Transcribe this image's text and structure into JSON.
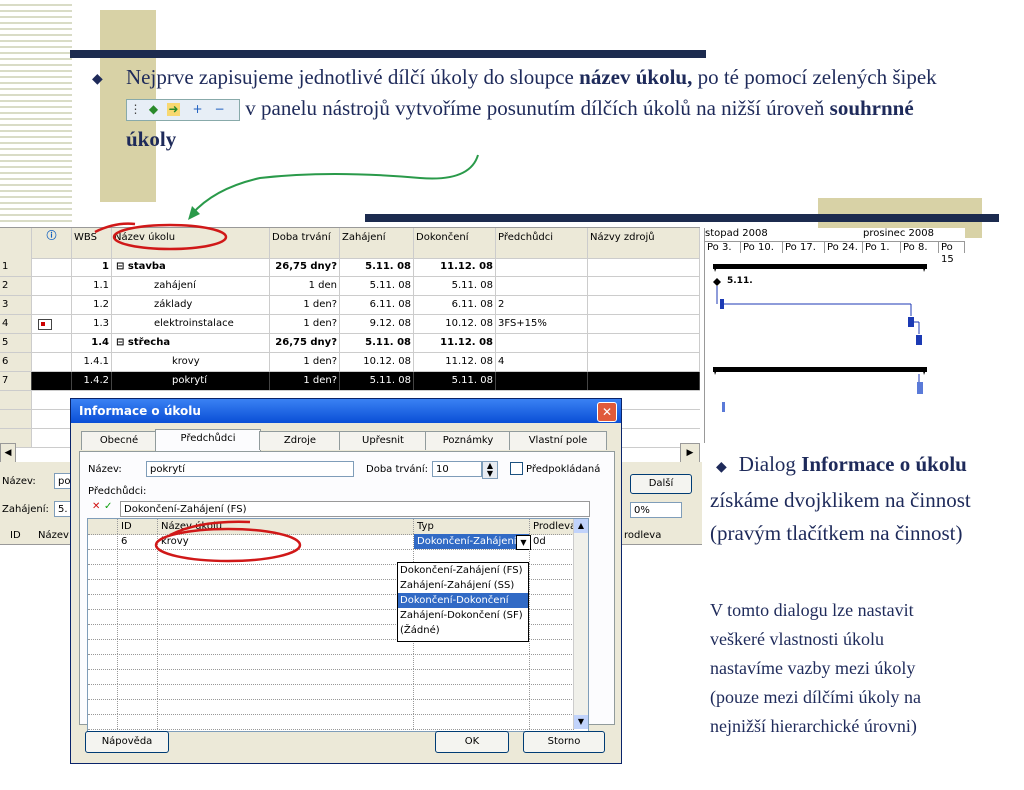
{
  "slide": {
    "bullet1": {
      "t1": "Nejprve zapisujeme jednotlivé dílčí úkoly do sloupce ",
      "b1": "název úkolu,",
      "t2": " po té pomocí zelených šipek ",
      "t3": " v panelu nástrojů vytvoříme posunutím dílčích úkolů na nižší úroveň ",
      "b2": "souhrnné úkoly"
    },
    "bullet2": {
      "t1": "Dialog ",
      "b1": "Informace o úkolu",
      "t2": " získáme dvojklikem na činnost (pravým tlačítkem na činnost)"
    },
    "notes": [
      "V tomto dialogu lze nastavit",
      "veškeré vlastnosti úkolu",
      "nastavíme vazby mezi úkoly",
      "(pouze mezi dílčími úkoly na",
      "nejnižší hierarchické úrovni)"
    ]
  },
  "project": {
    "headers": {
      "wbs": "WBS",
      "name": "Název úkolu",
      "duration": "Doba trvání",
      "start": "Zahájení",
      "finish": "Dokončení",
      "pred": "Předchůdci",
      "res": "Názvy zdrojů"
    },
    "rows": [
      {
        "n": "1",
        "wbs": "1",
        "name": "stavba",
        "dur": "26,75 dny?",
        "start": "5.11. 08",
        "finish": "11.12. 08",
        "pred": ""
      },
      {
        "n": "2",
        "wbs": "1.1",
        "name": "zahájení",
        "dur": "1 den",
        "start": "5.11. 08",
        "finish": "5.11. 08",
        "pred": ""
      },
      {
        "n": "3",
        "wbs": "1.2",
        "name": "základy",
        "dur": "1 den?",
        "start": "6.11. 08",
        "finish": "6.11. 08",
        "pred": "2"
      },
      {
        "n": "4",
        "wbs": "1.3",
        "name": "elektroinstalace",
        "dur": "1 den?",
        "start": "9.12. 08",
        "finish": "10.12. 08",
        "pred": "3FS+15%"
      },
      {
        "n": "5",
        "wbs": "1.4",
        "name": "střecha",
        "dur": "26,75 dny?",
        "start": "5.11. 08",
        "finish": "11.12. 08",
        "pred": ""
      },
      {
        "n": "6",
        "wbs": "1.4.1",
        "name": "krovy",
        "dur": "1 den?",
        "start": "10.12. 08",
        "finish": "11.12. 08",
        "pred": "4"
      },
      {
        "n": "7",
        "wbs": "1.4.2",
        "name": "pokrytí",
        "dur": "1 den?",
        "start": "5.11. 08",
        "finish": "5.11. 08",
        "pred": ""
      }
    ]
  },
  "gantt": {
    "month1": "stopad 2008",
    "month2": "prosinec 2008",
    "weeks": [
      "Po 3.",
      "Po 10.",
      "Po 17.",
      "Po 24.",
      "Po 1.",
      "Po 8.",
      "Po 15"
    ],
    "milestone_label": "5.11."
  },
  "form": {
    "name_label": "Název:",
    "name_value": "po",
    "start_label": "Zahájení:",
    "start_value": "5.",
    "col_id": "ID",
    "col_name": "Název"
  },
  "dialog": {
    "title": "Informace o úkolu",
    "tabs": [
      "Obecné",
      "Předchůdci",
      "Zdroje",
      "Upřesnit",
      "Poznámky",
      "Vlastní pole"
    ],
    "name_label": "Název:",
    "name_value": "pokrytí",
    "duration_label": "Doba trvání:",
    "duration_value": "10",
    "estimated_label": "Předpokládaná",
    "pred_label": "Předchůdci:",
    "edit_value": "Dokončení-Zahájení (FS)",
    "cols": {
      "id": "ID",
      "name": "Název úkolu",
      "type": "Typ",
      "lag": "Prodleva"
    },
    "row": {
      "id": "6",
      "name": "krovy",
      "type": "Dokončení-Zahájení",
      "lag": "0d"
    },
    "options": [
      "Dokončení-Zahájení (FS)",
      "Zahájení-Zahájení (SS)",
      "Dokončení-Dokončení (FF)",
      "Zahájení-Dokončení (SF)",
      "(Žádné)"
    ],
    "help_button": "Nápověda",
    "ok_button": "OK",
    "cancel_button": "Storno",
    "next_button": "Další",
    "pct_value": "0%",
    "lag_label": "rodleva"
  }
}
